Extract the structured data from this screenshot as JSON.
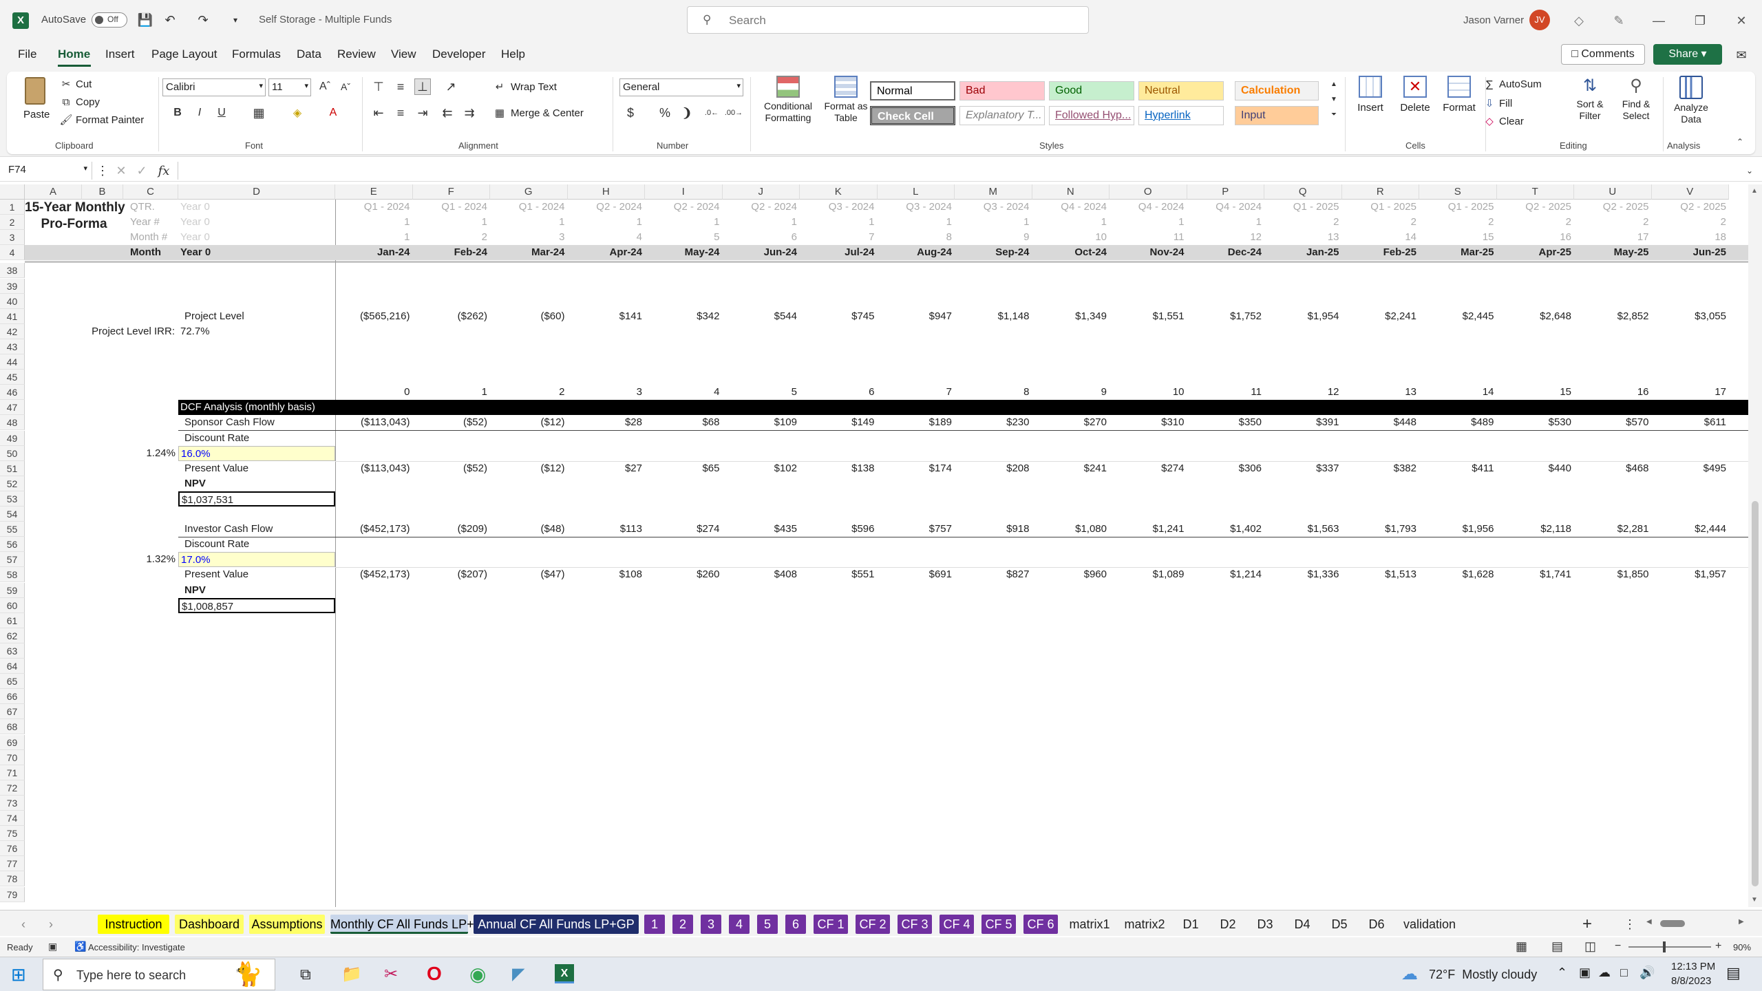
{
  "title_bar": {
    "autosave_label": "AutoSave",
    "autosave_state": "Off",
    "document_title": "Self Storage - Multiple Funds",
    "search_placeholder": "Search",
    "user_name": "Jason Varner",
    "user_initials": "JV"
  },
  "menu": {
    "items": [
      "File",
      "Home",
      "Insert",
      "Page Layout",
      "Formulas",
      "Data",
      "Review",
      "View",
      "Developer",
      "Help"
    ],
    "active": "Home",
    "comments_label": "Comments",
    "share_label": "Share"
  },
  "ribbon": {
    "clipboard": {
      "paste": "Paste",
      "cut": "Cut",
      "copy": "Copy",
      "format_painter": "Format Painter",
      "group": "Clipboard"
    },
    "font": {
      "name": "Calibri",
      "size": "11",
      "group": "Font"
    },
    "alignment": {
      "wrap_text": "Wrap Text",
      "merge_center": "Merge & Center",
      "group": "Alignment"
    },
    "number": {
      "format": "General",
      "group": "Number"
    },
    "styles": {
      "conditional": "Conditional Formatting",
      "format_table": "Format as Table",
      "group": "Styles",
      "cells": [
        {
          "label": "Normal",
          "bg": "#ffffff",
          "fg": "#000000"
        },
        {
          "label": "Bad",
          "bg": "#ffc7ce",
          "fg": "#9c0006"
        },
        {
          "label": "Good",
          "bg": "#c6efce",
          "fg": "#006100"
        },
        {
          "label": "Neutral",
          "bg": "#ffeb9c",
          "fg": "#9c5700"
        },
        {
          "label": "Calculation",
          "bg": "#f2f2f2",
          "fg": "#fa7d00"
        },
        {
          "label": "Check Cell",
          "bg": "#a5a5a5",
          "fg": "#ffffff"
        },
        {
          "label": "Explanatory T...",
          "bg": "#ffffff",
          "fg": "#7f7f7f"
        },
        {
          "label": "Followed Hyp...",
          "bg": "#ffffff",
          "fg": "#954f72"
        },
        {
          "label": "Hyperlink",
          "bg": "#ffffff",
          "fg": "#0563c1"
        },
        {
          "label": "Input",
          "bg": "#ffcc99",
          "fg": "#3f3f76"
        }
      ]
    },
    "cells": {
      "insert": "Insert",
      "delete": "Delete",
      "format": "Format",
      "group": "Cells"
    },
    "editing": {
      "autosum": "AutoSum",
      "fill": "Fill",
      "clear": "Clear",
      "sort_filter": "Sort & Filter",
      "find_select": "Find & Select",
      "group": "Editing"
    },
    "analysis": {
      "analyze": "Analyze Data",
      "group": "Analysis"
    }
  },
  "formula_bar": {
    "name_box": "F74",
    "formula": ""
  },
  "columns": [
    "A",
    "B",
    "C",
    "D",
    "E",
    "F",
    "G",
    "H",
    "I",
    "J",
    "K",
    "L",
    "M",
    "N",
    "O",
    "P",
    "Q",
    "R",
    "S",
    "T",
    "U",
    "V"
  ],
  "header_rows": {
    "labels": [
      {
        "row": "1",
        "label": "QTR.",
        "d": "Year 0"
      },
      {
        "row": "2",
        "label": "Year #",
        "d": "Year 0"
      },
      {
        "row": "3",
        "label": "Month #",
        "d": "Year 0"
      },
      {
        "row": "4",
        "label": "Month",
        "d": "Year 0"
      }
    ],
    "title_line1": "15-Year Monthly",
    "title_line2": "Pro-Forma",
    "qtr": [
      "Q1 - 2024",
      "Q1 - 2024",
      "Q1 - 2024",
      "Q2 - 2024",
      "Q2 - 2024",
      "Q2 - 2024",
      "Q3 - 2024",
      "Q3 - 2024",
      "Q3 - 2024",
      "Q4 - 2024",
      "Q4 - 2024",
      "Q4 - 2024",
      "Q1 - 2025",
      "Q1 - 2025",
      "Q1 - 2025",
      "Q2 - 2025",
      "Q2 - 2025",
      "Q2 - 2025"
    ],
    "year": [
      "1",
      "1",
      "1",
      "1",
      "1",
      "1",
      "1",
      "1",
      "1",
      "1",
      "1",
      "1",
      "2",
      "2",
      "2",
      "2",
      "2",
      "2"
    ],
    "month_num": [
      "1",
      "2",
      "3",
      "4",
      "5",
      "6",
      "7",
      "8",
      "9",
      "10",
      "11",
      "12",
      "13",
      "14",
      "15",
      "16",
      "17",
      "18"
    ],
    "month": [
      "Jan-24",
      "Feb-24",
      "Mar-24",
      "Apr-24",
      "May-24",
      "Jun-24",
      "Jul-24",
      "Aug-24",
      "Sep-24",
      "Oct-24",
      "Nov-24",
      "Dec-24",
      "Jan-25",
      "Feb-25",
      "Mar-25",
      "Apr-25",
      "May-25",
      "Jun-25"
    ]
  },
  "row_numbers": [
    "38",
    "39",
    "40",
    "41",
    "42",
    "43",
    "44",
    "45",
    "46",
    "47",
    "48",
    "49",
    "50",
    "51",
    "52",
    "53",
    "54",
    "55",
    "56",
    "57",
    "58",
    "59",
    "60",
    "61",
    "62",
    "63",
    "64",
    "65",
    "66",
    "67",
    "68",
    "69",
    "70",
    "71",
    "72",
    "73",
    "74",
    "75",
    "76",
    "77",
    "78",
    "79"
  ],
  "body": {
    "project_level_label": "Project Level",
    "project_level": [
      "($565,216)",
      "($262)",
      "($60)",
      "$141",
      "$342",
      "$544",
      "$745",
      "$947",
      "$1,148",
      "$1,349",
      "$1,551",
      "$1,752",
      "$1,954",
      "$2,241",
      "$2,445",
      "$2,648",
      "$2,852",
      "$3,055"
    ],
    "irr_label": "Project Level IRR:",
    "irr_value": "72.7%",
    "period_index": [
      "0",
      "1",
      "2",
      "3",
      "4",
      "5",
      "6",
      "7",
      "8",
      "9",
      "10",
      "11",
      "12",
      "13",
      "14",
      "15",
      "16",
      "17"
    ],
    "dcf_header": "DCF Analysis (monthly basis)",
    "sponsor_label": "Sponsor Cash Flow",
    "sponsor_cf": [
      "($113,043)",
      "($52)",
      "($12)",
      "$28",
      "$68",
      "$109",
      "$149",
      "$189",
      "$230",
      "$270",
      "$310",
      "$350",
      "$391",
      "$448",
      "$489",
      "$530",
      "$570",
      "$611"
    ],
    "discount_label": "Discount Rate",
    "sponsor_monthly_rate": "1.24%",
    "sponsor_discount": "16.0%",
    "pv_label": "Present Value",
    "sponsor_pv": [
      "($113,043)",
      "($52)",
      "($12)",
      "$27",
      "$65",
      "$102",
      "$138",
      "$174",
      "$208",
      "$241",
      "$274",
      "$306",
      "$337",
      "$382",
      "$411",
      "$440",
      "$468",
      "$495"
    ],
    "npv_label": "NPV",
    "sponsor_npv": "$1,037,531",
    "investor_label": "Investor Cash Flow",
    "investor_cf": [
      "($452,173)",
      "($209)",
      "($48)",
      "$113",
      "$274",
      "$435",
      "$596",
      "$757",
      "$918",
      "$1,080",
      "$1,241",
      "$1,402",
      "$1,563",
      "$1,793",
      "$1,956",
      "$2,118",
      "$2,281",
      "$2,444"
    ],
    "investor_monthly_rate": "1.32%",
    "investor_discount": "17.0%",
    "investor_pv": [
      "($452,173)",
      "($207)",
      "($47)",
      "$108",
      "$260",
      "$408",
      "$551",
      "$691",
      "$827",
      "$960",
      "$1,089",
      "$1,214",
      "$1,336",
      "$1,513",
      "$1,628",
      "$1,741",
      "$1,850",
      "$1,957"
    ],
    "investor_npv": "$1,008,857"
  },
  "sheet_tabs": [
    {
      "label": "Instruction",
      "bg": "#ffff00",
      "fg": "#000000"
    },
    {
      "label": "Dashboard",
      "bg": "#ffff66",
      "fg": "#000000"
    },
    {
      "label": "Assumptions",
      "bg": "#ffff66",
      "fg": "#000000"
    },
    {
      "label": "Monthly CF All Funds LP+GP",
      "bg": "#c9d6ea",
      "fg": "#000000"
    },
    {
      "label": "Annual CF All Funds LP+GP",
      "bg": "#1f2d6b",
      "fg": "#ffffff"
    },
    {
      "label": "1",
      "bg": "#7030a0",
      "fg": "#ffffff"
    },
    {
      "label": "2",
      "bg": "#7030a0",
      "fg": "#ffffff"
    },
    {
      "label": "3",
      "bg": "#7030a0",
      "fg": "#ffffff"
    },
    {
      "label": "4",
      "bg": "#7030a0",
      "fg": "#ffffff"
    },
    {
      "label": "5",
      "bg": "#7030a0",
      "fg": "#ffffff"
    },
    {
      "label": "6",
      "bg": "#7030a0",
      "fg": "#ffffff"
    },
    {
      "label": "CF 1",
      "bg": "#7030a0",
      "fg": "#ffffff"
    },
    {
      "label": "CF 2",
      "bg": "#7030a0",
      "fg": "#ffffff"
    },
    {
      "label": "CF 3",
      "bg": "#7030a0",
      "fg": "#ffffff"
    },
    {
      "label": "CF 4",
      "bg": "#7030a0",
      "fg": "#ffffff"
    },
    {
      "label": "CF 5",
      "bg": "#7030a0",
      "fg": "#ffffff"
    },
    {
      "label": "CF 6",
      "bg": "#7030a0",
      "fg": "#ffffff"
    },
    {
      "label": "matrix1",
      "bg": "",
      "fg": "#222222"
    },
    {
      "label": "matrix2",
      "bg": "",
      "fg": "#222222"
    },
    {
      "label": "D1",
      "bg": "",
      "fg": "#222222"
    },
    {
      "label": "D2",
      "bg": "",
      "fg": "#222222"
    },
    {
      "label": "D3",
      "bg": "",
      "fg": "#222222"
    },
    {
      "label": "D4",
      "bg": "",
      "fg": "#222222"
    },
    {
      "label": "D5",
      "bg": "",
      "fg": "#222222"
    },
    {
      "label": "D6",
      "bg": "",
      "fg": "#222222"
    },
    {
      "label": "validation",
      "bg": "",
      "fg": "#222222"
    }
  ],
  "status_bar": {
    "ready": "Ready",
    "accessibility": "Accessibility: Investigate",
    "zoom": "90%"
  },
  "taskbar": {
    "search_placeholder": "Type here to search",
    "weather": "72°F  Mostly cloudy",
    "time": "12:13 PM",
    "date": "8/8/2023"
  }
}
